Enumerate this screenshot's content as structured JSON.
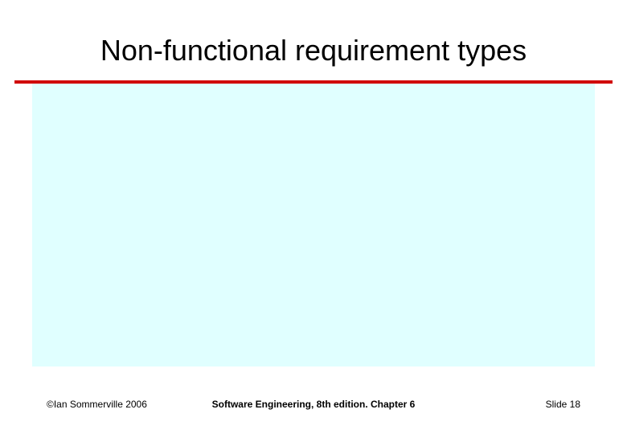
{
  "slide": {
    "title": "Non-functional requirement types",
    "footer": {
      "left": "©Ian Sommerville 2006",
      "center": "Software Engineering, 8th edition. Chapter 6",
      "right_label": "Slide ",
      "right_number": "18"
    }
  }
}
